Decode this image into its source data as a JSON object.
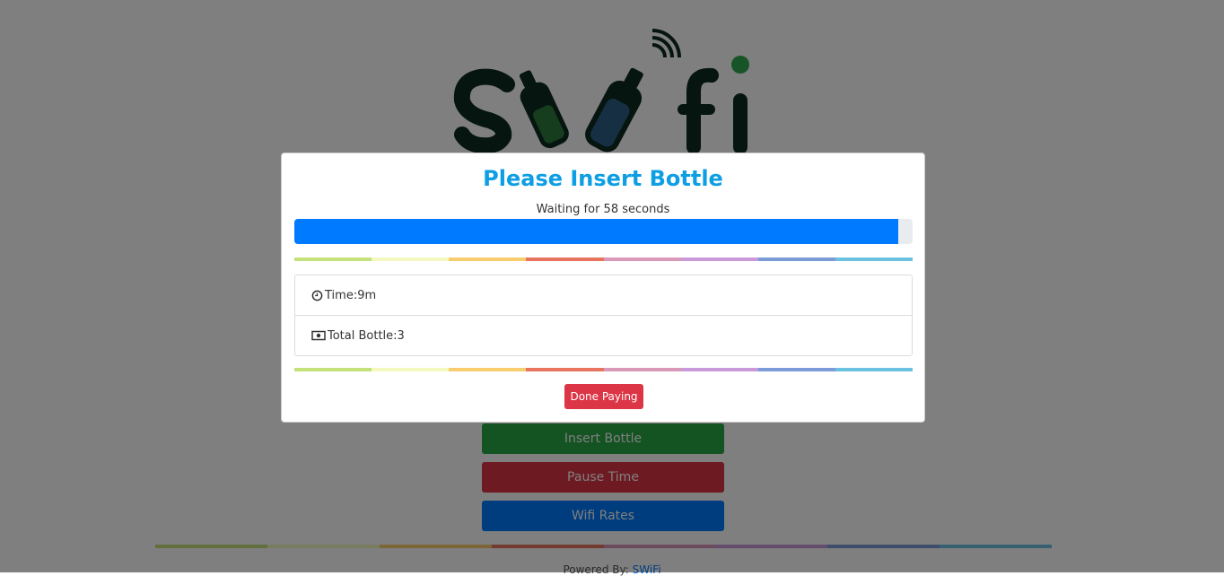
{
  "background": {
    "logo_text": "SWifi",
    "buttons": {
      "insert_bottle": "Insert Bottle",
      "pause_time": "Pause Time",
      "wifi_rates": "Wifi Rates"
    },
    "footer": {
      "powered_by": "Powered By:",
      "brand": "SWiFi"
    }
  },
  "modal": {
    "title": "Please Insert Bottle",
    "waiting_text": "Waiting for 58 seconds",
    "progress_fraction": 0.977,
    "items": [
      {
        "label": "Time:9m",
        "icon": "clock-icon"
      },
      {
        "label": "Total Bottle:3",
        "icon": "money-icon"
      }
    ],
    "done_button": "Done Paying"
  },
  "colors": {
    "title": "#0d9ee3",
    "progress": "#007bff",
    "done": "#dc3545",
    "insert": "#28a745",
    "pause": "#dc3545",
    "rates": "#007bff",
    "rainbow": [
      "#c5e17a",
      "#f3f8be",
      "#f8cd6d",
      "#e6745f",
      "#d999b9",
      "#c999d9",
      "#7c9bd9",
      "#6cc1e0"
    ]
  }
}
